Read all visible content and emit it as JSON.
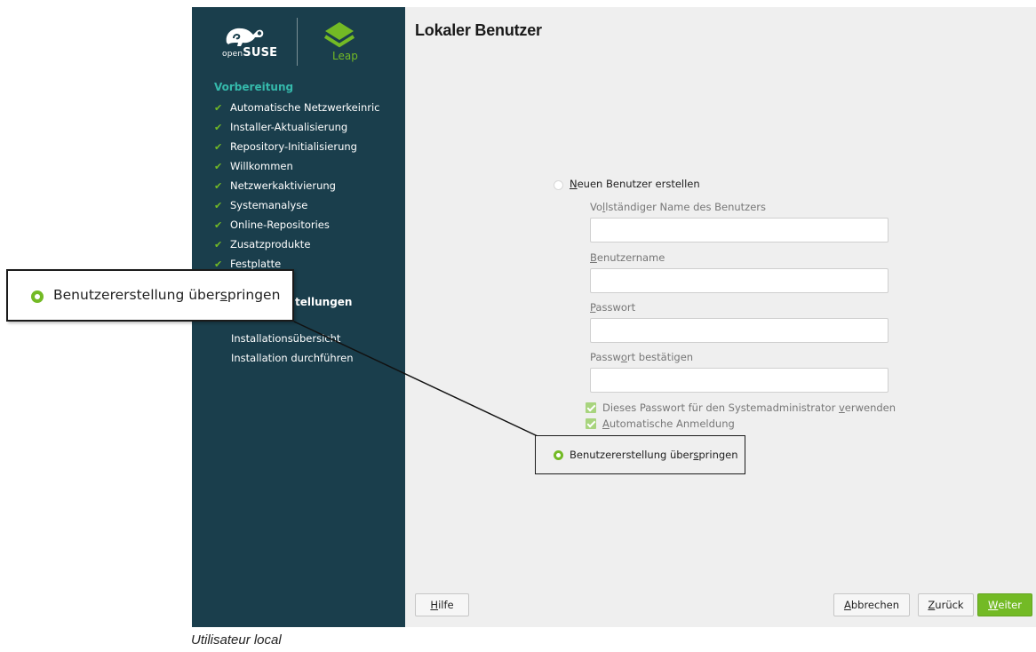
{
  "window": {
    "title": "Lokaler Benutzer"
  },
  "brand": {
    "opensuse_prefix": "open",
    "opensuse_suffix": "SUSE",
    "leap": "Leap",
    "accent_color": "#73ba25",
    "sidebar_color": "#1a3e4c"
  },
  "sidebar": {
    "section1_title": "Vorbereitung",
    "section1_items": [
      "Automatische Netzwerkeinric",
      "Installer-Aktualisierung",
      "Repository-Initialisierung",
      "Willkommen",
      "Netzwerkaktivierung",
      "Systemanalyse",
      "Online-Repositories",
      "Zusatzprodukte",
      "Festplatte"
    ],
    "section2_title_partial": "tellungen",
    "section3_items": [
      "Installationsübersicht",
      "Installation durchführen"
    ]
  },
  "form": {
    "option_new_user": {
      "pre": "",
      "ul": "N",
      "post": "euen Benutzer erstellen"
    },
    "full_name": {
      "pre": "Vo",
      "ul": "l",
      "post": "lständiger Name des Benutzers",
      "value": ""
    },
    "username": {
      "pre": "",
      "ul": "B",
      "post": "enutzername",
      "value": ""
    },
    "password": {
      "pre": "",
      "ul": "P",
      "post": "asswort",
      "value": ""
    },
    "password_confirm": {
      "pre": "Passw",
      "ul": "o",
      "post": "rt bestätigen",
      "value": ""
    },
    "checkbox_admin": {
      "pre": "Dieses Passwort für den Systemadministrator ",
      "ul": "v",
      "post": "erwenden",
      "checked": true
    },
    "checkbox_autologin": {
      "pre": "",
      "ul": "A",
      "post": "utomatische Anmeldung",
      "checked": true
    },
    "option_skip": {
      "pre": "Benutzererstellung über",
      "ul": "s",
      "post": "pringen",
      "selected": true
    }
  },
  "buttons": {
    "help": {
      "pre": "",
      "ul": "H",
      "post": "ilfe"
    },
    "abort": {
      "pre": "",
      "ul": "A",
      "post": "bbrechen"
    },
    "back": {
      "pre": "",
      "ul": "Z",
      "post": "urück"
    },
    "next": {
      "pre": "",
      "ul": "W",
      "post": "eiter"
    }
  },
  "callout": {
    "pre": "Benutzererstellung über",
    "ul": "s",
    "post": "pringen"
  },
  "caption": "Utilisateur local"
}
